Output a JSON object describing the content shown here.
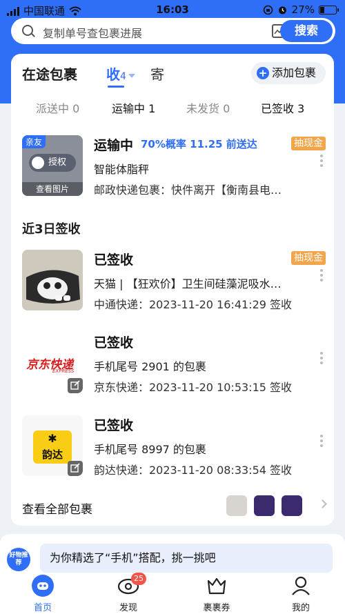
{
  "status_bar": {
    "carrier": "中国联通",
    "time": "16:03",
    "battery": "27%"
  },
  "search": {
    "placeholder": "复制单号查包裹进展",
    "button": "搜索"
  },
  "header": {
    "title": "在途包裹",
    "tab_receive": "收",
    "tab_receive_count": "4",
    "tab_send": "寄",
    "add_button": "添加包裹"
  },
  "subtabs": [
    {
      "label": "派送中 0"
    },
    {
      "label": "运输中 1"
    },
    {
      "label": "未发货 0"
    },
    {
      "label": "已签收 3"
    }
  ],
  "in_transit": {
    "tag": "亲友",
    "auth": "授权",
    "view_image": "查看图片",
    "status": "运输中",
    "eta": "70%概率 11.25 前送达",
    "cash": "抽现金",
    "item": "智能体脂秤",
    "detail": "邮政快递包裹：快件离开【衡南县电…"
  },
  "recent_title": "近3日签收",
  "signed": [
    {
      "status": "已签收",
      "cash": "抽现金",
      "item": "天猫 | 【狂欢价】卫生间硅藻泥吸水…",
      "detail": "中通快递：2023-11-20 16:41:29 签收"
    },
    {
      "status": "已签收",
      "logo_text": "京东快递",
      "logo_sub": "EXPRESS",
      "item": "手机尾号 2901 的包裹",
      "detail": "京东快递：2023-11-20 10:53:15 签收"
    },
    {
      "status": "已签收",
      "logo_text": "韵达",
      "item": "手机尾号 8997 的包裹",
      "detail": "韵达快递：2023-11-20 08:33:54 签收"
    }
  ],
  "view_all": "查看全部包裹",
  "promo": {
    "badge": "好物推荐",
    "message": "为你精选了“手机”搭配，挑一挑吧"
  },
  "tabbar": [
    {
      "label": "首页"
    },
    {
      "label": "发现",
      "badge": "25"
    },
    {
      "label": "裹裹券"
    },
    {
      "label": "我的"
    }
  ],
  "colors": {
    "brand": "#2f6ef7",
    "cash": "#f2a54a",
    "badge": "#f4554a"
  }
}
